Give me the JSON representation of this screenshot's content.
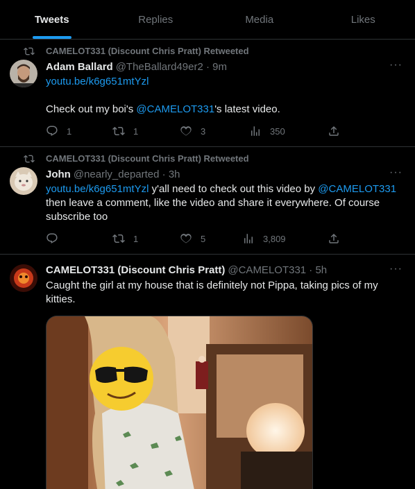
{
  "tabs": [
    {
      "label": "Tweets",
      "active": true
    },
    {
      "label": "Replies",
      "active": false
    },
    {
      "label": "Media",
      "active": false
    },
    {
      "label": "Likes",
      "active": false
    }
  ],
  "colors": {
    "accent": "#1d9bf0",
    "text": "#e7e9ea",
    "muted": "#71767b",
    "border": "#2f3336",
    "background": "#000000"
  },
  "tweets": [
    {
      "retweet_label": "CAMELOT331 (Discount Chris Pratt) Retweeted",
      "name": "Adam Ballard",
      "meta": "@TheBallard49er2 · 9m",
      "link": "youtu.be/k6g651mtYzl",
      "text_before": "Check out my boi's ",
      "mention": "@CAMELOT331",
      "text_after": "'s latest video.",
      "replies": "1",
      "retweets": "1",
      "likes": "3",
      "views": "350"
    },
    {
      "retweet_label": "CAMELOT331 (Discount Chris Pratt) Retweeted",
      "name": "John",
      "meta": "@nearly_departed · 3h",
      "link": "youtu.be/k6g651mtYzl",
      "text_mid": " y'all need to check out this video by ",
      "mention": "@CAMELOT331",
      "text_after": " then leave a comment, like the video and share it everywhere. Of course subscribe too",
      "replies": "",
      "retweets": "1",
      "likes": "5",
      "views": "3,809"
    },
    {
      "name": "CAMELOT331 (Discount Chris Pratt)",
      "meta": "@CAMELOT331 · 5h",
      "text": "Caught the girl at my house that is definitely not Pippa, taking pics of my kitties.",
      "media_icon": "photo"
    }
  ],
  "icons": {
    "more": "···",
    "reply": "reply-icon",
    "retweet": "retweet-icon",
    "like": "heart-icon",
    "views": "views-icon",
    "share": "share-icon"
  }
}
